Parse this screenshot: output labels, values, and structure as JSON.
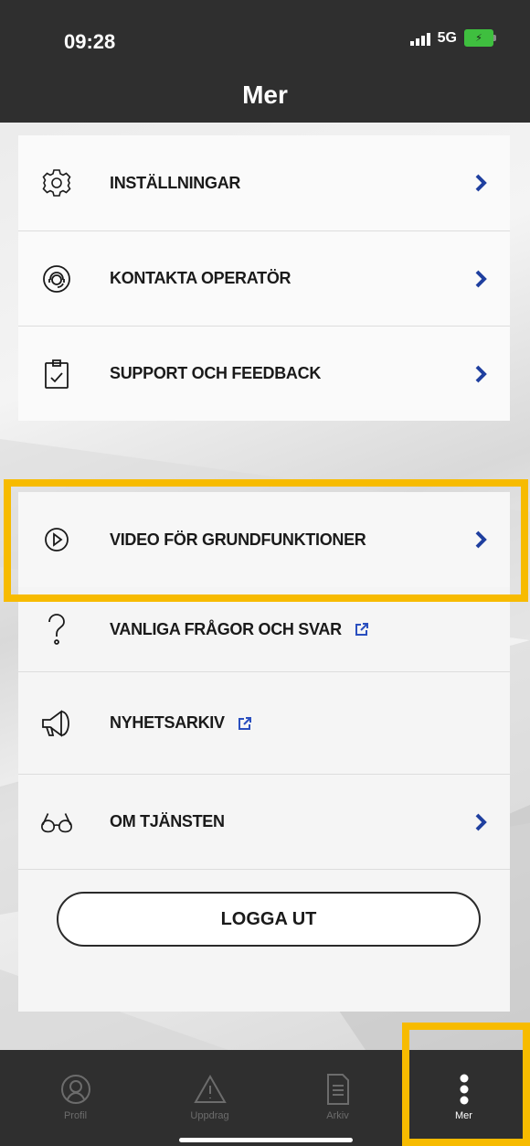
{
  "status_bar": {
    "time": "09:28",
    "network": "5G"
  },
  "header": {
    "title": "Mer"
  },
  "menu": {
    "group1": [
      {
        "label": "INSTÄLLNINGAR",
        "icon": "gear-icon",
        "trailing": "chevron"
      },
      {
        "label": "KONTAKTA OPERATÖR",
        "icon": "operator-headset-icon",
        "trailing": "chevron"
      },
      {
        "label": "SUPPORT OCH FEEDBACK",
        "icon": "clipboard-check-icon",
        "trailing": "chevron"
      }
    ],
    "group2": [
      {
        "label": "VIDEO FÖR GRUNDFUNKTIONER",
        "icon": "play-circle-icon",
        "trailing": "chevron"
      },
      {
        "label": "VANLIGA FRÅGOR OCH SVAR",
        "icon": "question-mark-icon",
        "trailing": "external-link"
      },
      {
        "label": "NYHETSARKIV",
        "icon": "megaphone-icon",
        "trailing": "external-link"
      },
      {
        "label": "OM TJÄNSTEN",
        "icon": "glasses-icon",
        "trailing": "chevron"
      }
    ]
  },
  "logout": {
    "label": "LOGGA UT"
  },
  "tabbar": {
    "tabs": [
      {
        "label": "Profil",
        "icon": "profile-icon",
        "active": false
      },
      {
        "label": "Uppdrag",
        "icon": "warning-triangle-icon",
        "active": false
      },
      {
        "label": "Arkiv",
        "icon": "document-icon",
        "active": false
      },
      {
        "label": "Mer",
        "icon": "more-vertical-icon",
        "active": true
      }
    ]
  },
  "colors": {
    "header_bg": "#2f2f2f",
    "accent_chevron": "#1f3f9f",
    "highlight": "#f7bb00",
    "tab_inactive": "#6c6c6c",
    "tab_active": "#ffffff"
  }
}
